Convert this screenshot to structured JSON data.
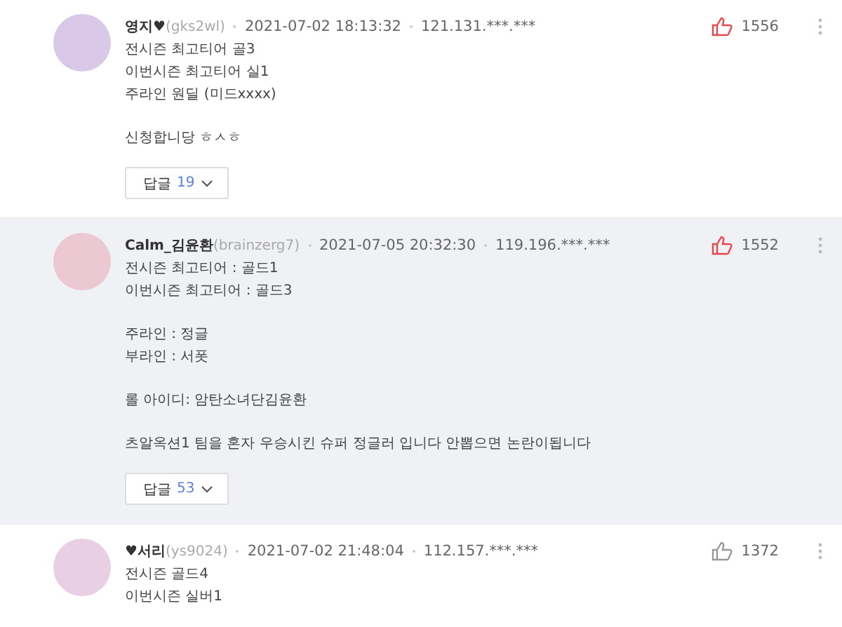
{
  "comments": [
    {
      "name": "영지♥",
      "user_id": "(gks2wl)",
      "date": "2021-07-02 18:13:32",
      "ip": "121.131.***.***",
      "upvoted": true,
      "upvotes": "1556",
      "hovered": false,
      "paragraphs": [
        [
          "전시즌 최고티어 골3",
          "이번시즌 최고티어 실1",
          "주라인 원딜 (미드xxxx)"
        ],
        [
          "신청합니당 ㅎㅅㅎ"
        ]
      ],
      "reply_label": "답글",
      "reply_count": "19"
    },
    {
      "name": "Calm_김윤환",
      "user_id": "(brainzerg7)",
      "date": "2021-07-05 20:32:30",
      "ip": "119.196.***.***",
      "upvoted": true,
      "upvotes": "1552",
      "hovered": true,
      "paragraphs": [
        [
          "전시즌 최고티어 : 골드1",
          "이번시즌 최고티어 : 골드3"
        ],
        [
          "주라인 : 정글",
          "부라인 : 서폿"
        ],
        [
          "롤 아이디: 암탄소녀단김윤환"
        ],
        [
          "츠알옥션1 팀을 혼자 우승시킨 슈퍼 정글러 입니다 안뽑으면 논란이됩니다"
        ]
      ],
      "reply_label": "답글",
      "reply_count": "53"
    },
    {
      "name": "♥서리",
      "user_id": "(ys9024)",
      "date": "2021-07-02 21:48:04",
      "ip": "112.157.***.***",
      "upvoted": false,
      "upvotes": "1372",
      "hovered": false,
      "paragraphs": [
        [
          "전시즌 골드4",
          "이번시즌 실버1"
        ]
      ]
    }
  ]
}
